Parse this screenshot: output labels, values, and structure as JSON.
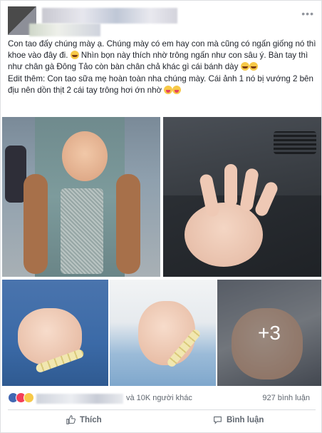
{
  "post": {
    "paragraph1": "Con tao đấy chúng mày ạ. Chúng mày có em hay con mà cũng có ngấn giống nó thì khoe vào đây đi.",
    "paragraph1b": "Nhìn bọn này thích nhờ trông ngấn như con sâu ý. Bàn tay thì như chân gà Đông Tảo còn bàn chân chả khác gì cái bánh dày",
    "paragraph2": "Edit thêm: Con tao sữa mẹ hoàn toàn nha chúng mày. Cái ảnh 1 nó bị vướng 2 bên địu nên dồn thịt 2 cái tay trông hơi ớn nhờ"
  },
  "photos": {
    "more_count": "+3"
  },
  "reactions": {
    "others_text": "và 10K người khác",
    "comments_text": "927 bình luận"
  },
  "actions": {
    "like_label": "Thích",
    "comment_label": "Bình luận"
  },
  "colors": {
    "like_blue": "#4267b2",
    "love_red": "#f33e58",
    "haha_yellow": "#f7c948"
  }
}
